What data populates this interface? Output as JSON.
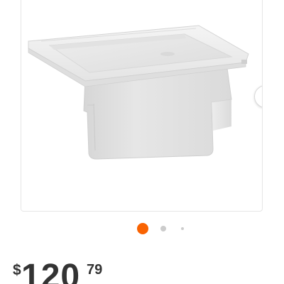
{
  "carousel": {
    "total_images": 3,
    "active_index": 0,
    "active_color": "#f96302",
    "inactive_color": "#cccccc"
  },
  "product_image": {
    "description_icon": "utility-sink-image"
  },
  "next_button": {
    "icon": "chevron-right-icon",
    "icon_color": "#f96302"
  },
  "price": {
    "currency": "$",
    "dollars": "120",
    "cents": "79"
  }
}
